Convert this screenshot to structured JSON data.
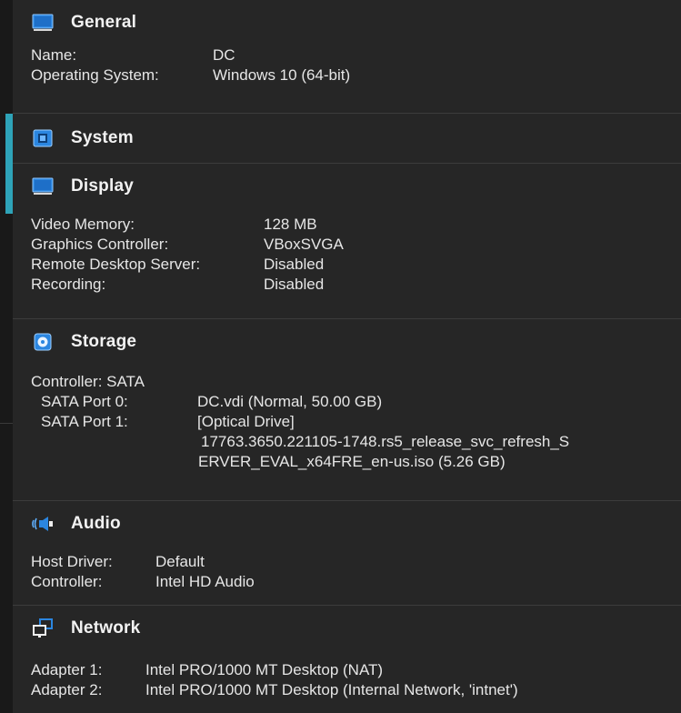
{
  "general": {
    "title": "General",
    "icon": "monitor-icon",
    "rows": [
      {
        "key": "Name:",
        "value": "DC"
      },
      {
        "key": "Operating System:",
        "value": "Windows 10 (64-bit)"
      }
    ]
  },
  "system": {
    "title": "System",
    "icon": "chip-icon"
  },
  "display": {
    "title": "Display",
    "icon": "monitor-icon",
    "rows": [
      {
        "key": "Video Memory:",
        "value": "128 MB"
      },
      {
        "key": "Graphics Controller:",
        "value": "VBoxSVGA"
      },
      {
        "key": "Remote Desktop Server:",
        "value": "Disabled"
      },
      {
        "key": "Recording:",
        "value": "Disabled"
      }
    ]
  },
  "storage": {
    "title": "Storage",
    "icon": "disk-icon",
    "controller": "Controller: SATA",
    "ports": [
      {
        "key": "SATA Port 0:",
        "value": "DC.vdi (Normal, 50.00 GB)"
      },
      {
        "key": "SATA Port 1:",
        "value": "[Optical Drive]"
      }
    ],
    "iso_line1": "17763.3650.221105-1748.rs5_release_svc_refresh_S",
    "iso_line2": "ERVER_EVAL_x64FRE_en-us.iso (5.26 GB)"
  },
  "audio": {
    "title": "Audio",
    "icon": "speaker-icon",
    "rows": [
      {
        "key": "Host Driver:",
        "value": "Default"
      },
      {
        "key": "Controller:",
        "value": "Intel HD Audio"
      }
    ]
  },
  "network": {
    "title": "Network",
    "icon": "network-icon",
    "rows": [
      {
        "key": "Adapter 1:",
        "value": "Intel PRO/1000 MT Desktop (NAT)"
      },
      {
        "key": "Adapter 2:",
        "value": "Intel PRO/1000 MT Desktop (Internal Network, 'intnet')"
      }
    ]
  },
  "colors": {
    "background": "#262626",
    "accent": "#2ea3b8",
    "icon_blue": "#2b86e0",
    "text": "#e6e6e6"
  }
}
